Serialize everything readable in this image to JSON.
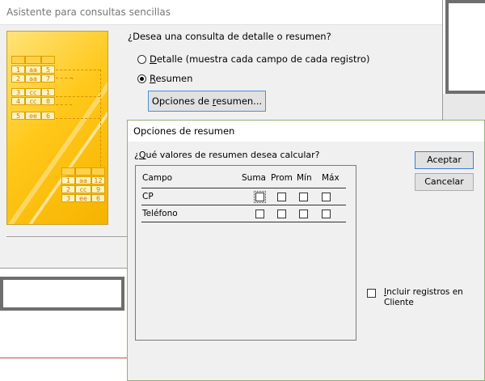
{
  "wizard": {
    "title": "Asistente para consultas sencillas",
    "question": "¿Desea una consulta de detalle o resumen?",
    "option_detail": "Detalle (muestra cada campo de cada registro)",
    "option_summary": "Resumen",
    "summary_options_button": "Opciones de resumen...",
    "selected_option": "Resumen",
    "sample_rows_top": [
      [
        "1",
        "aa",
        "5"
      ],
      [
        "2",
        "aa",
        "7"
      ],
      [
        "3",
        "cc",
        "1"
      ],
      [
        "4",
        "cc",
        "8"
      ],
      [
        "5",
        "ee",
        "6"
      ]
    ],
    "sample_rows_bottom": [
      [
        "1",
        "aa",
        "12"
      ],
      [
        "2",
        "cc",
        "9"
      ],
      [
        "3",
        "ee",
        "6"
      ]
    ]
  },
  "options_dialog": {
    "title": "Opciones de resumen",
    "question": "¿Qué valores de resumen desea calcular?",
    "columns": {
      "field": "Campo",
      "sum": "Suma",
      "avg": "Prom",
      "min": "Mín",
      "max": "Máx"
    },
    "rows": [
      {
        "field": "CP",
        "sum": false,
        "avg": false,
        "min": false,
        "max": false
      },
      {
        "field": "Teléfono",
        "sum": false,
        "avg": false,
        "min": false,
        "max": false
      }
    ],
    "ok_button": "Aceptar",
    "cancel_button": "Cancelar",
    "include_records_label": "Incluir registros en Cliente",
    "include_records_checked": false
  }
}
